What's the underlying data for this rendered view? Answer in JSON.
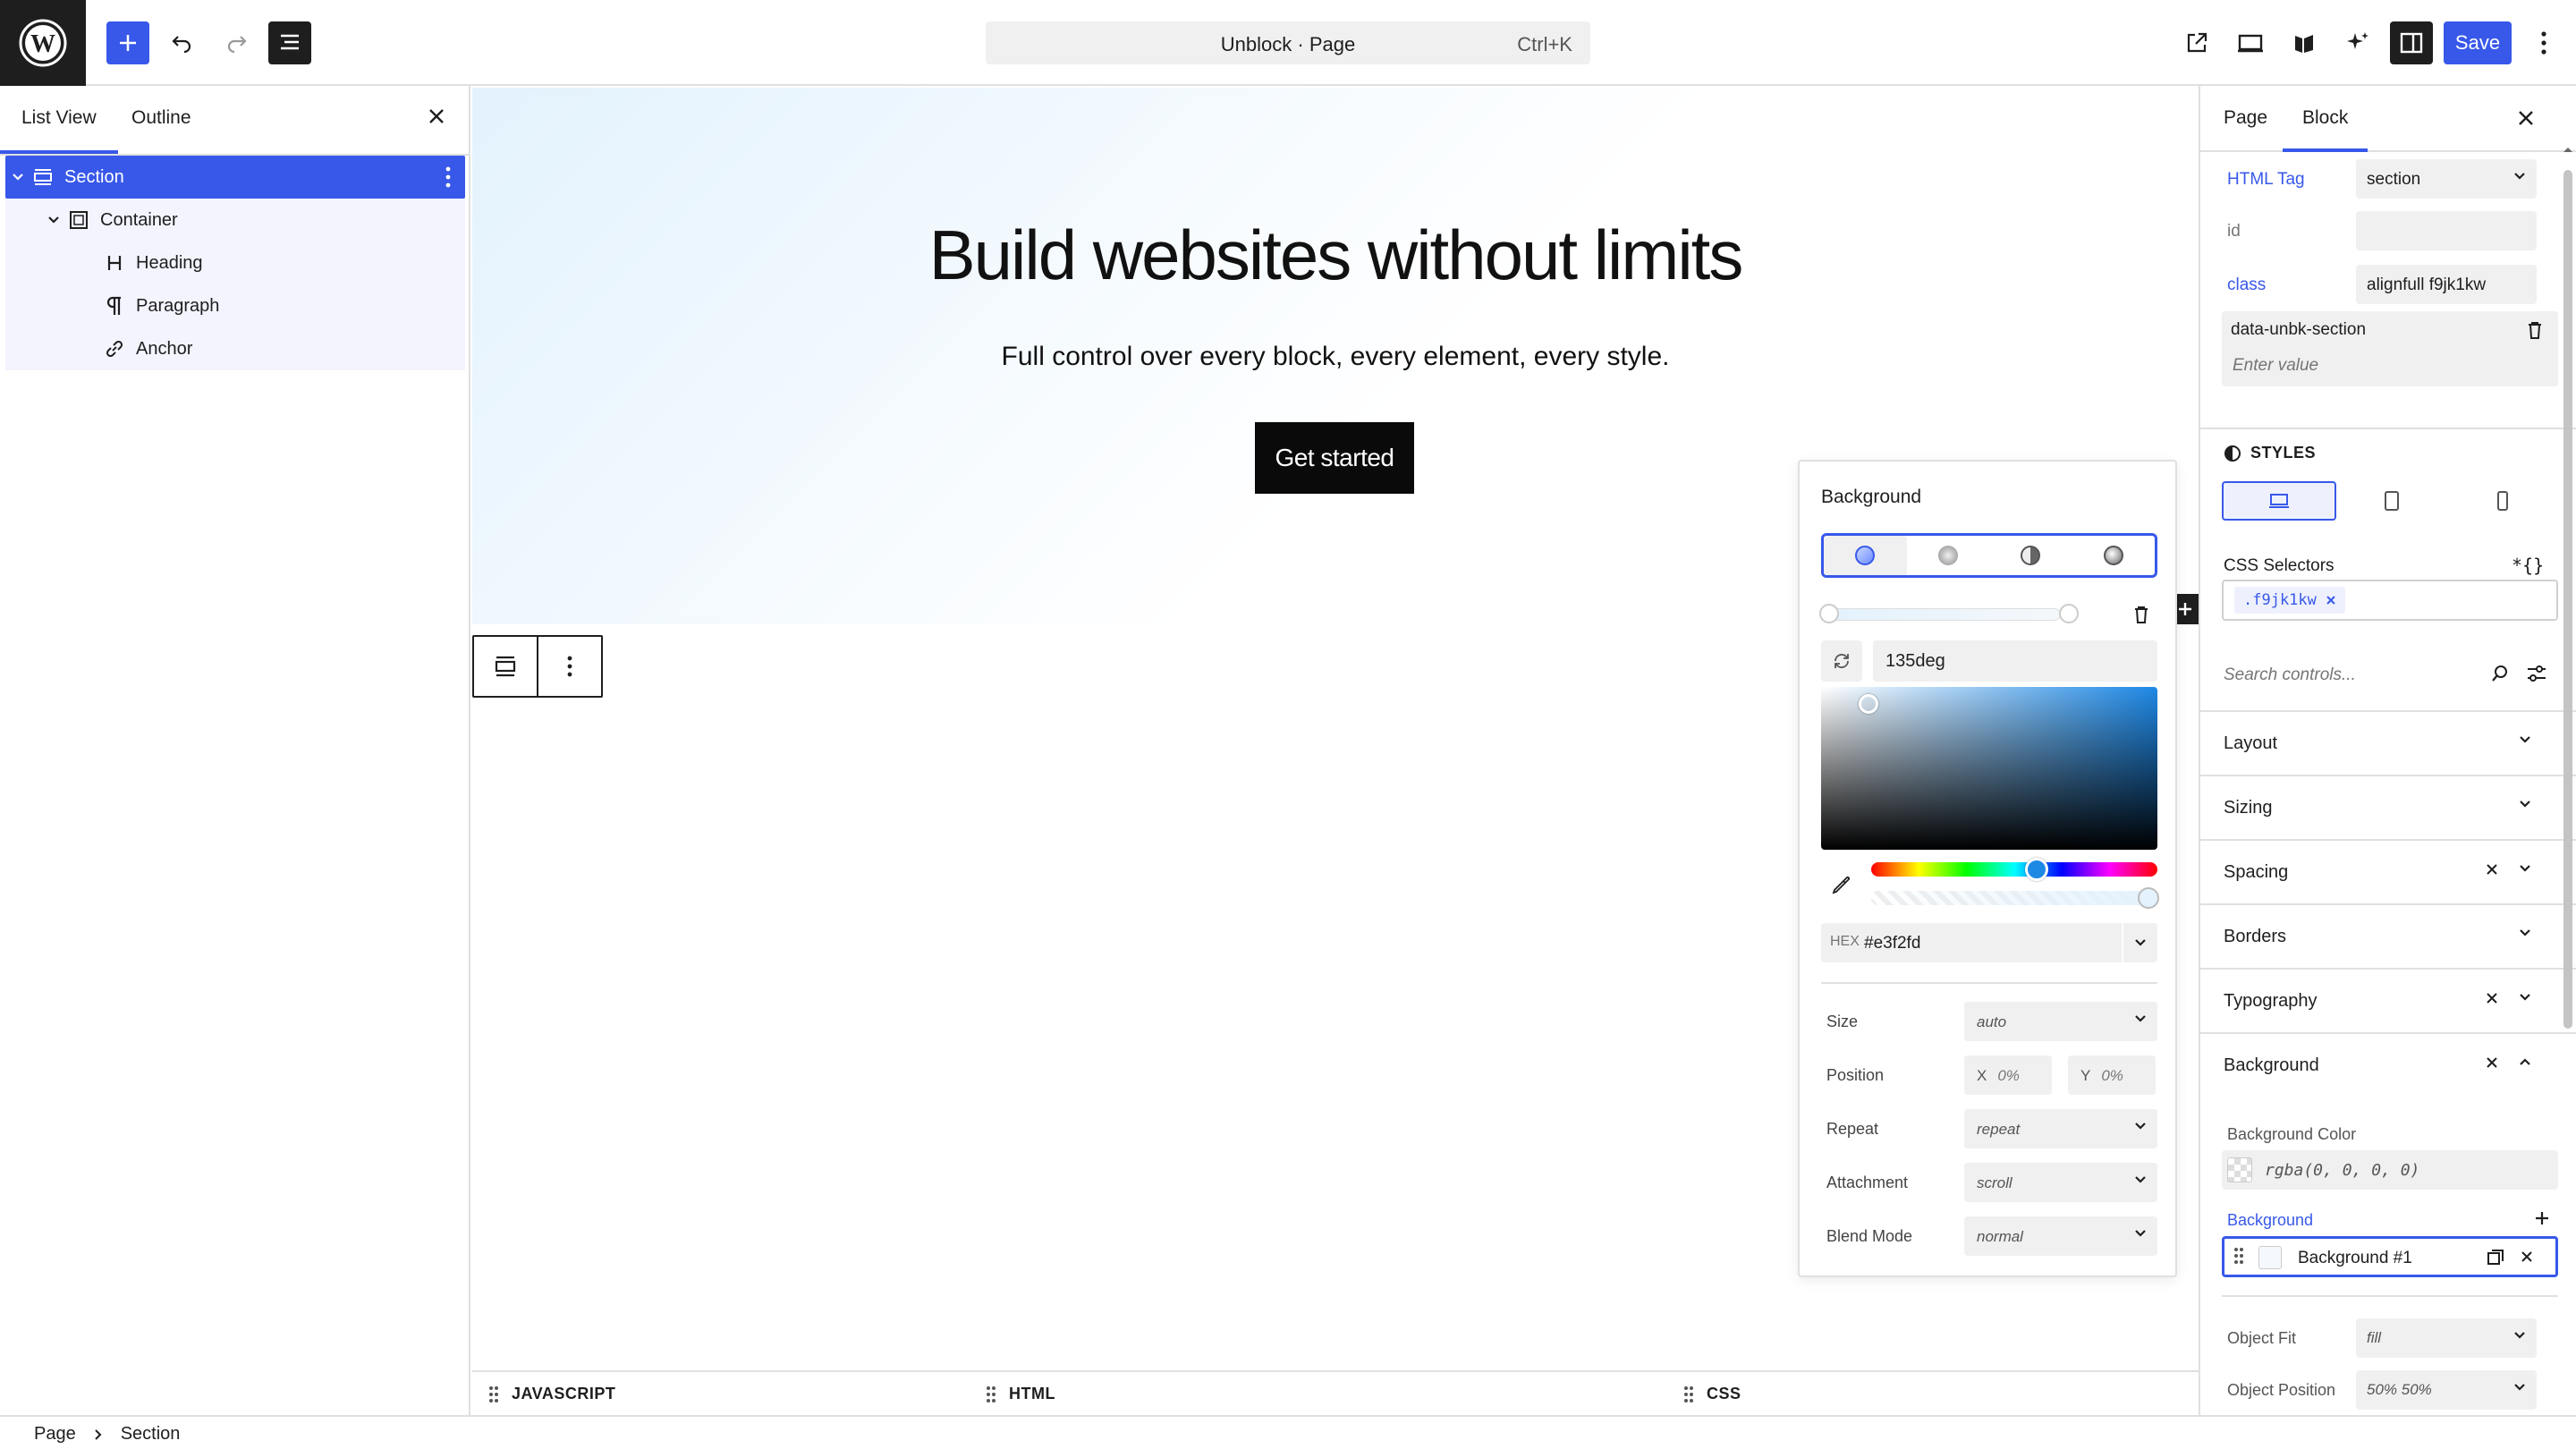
{
  "topbar": {
    "command_title": "Unblock · Page",
    "command_shortcut": "Ctrl+K",
    "save_label": "Save"
  },
  "left_panel": {
    "tabs": [
      "List View",
      "Outline"
    ],
    "tree": [
      {
        "label": "Section",
        "icon": "section-icon",
        "depth": 0,
        "selected": true
      },
      {
        "label": "Container",
        "icon": "container-icon",
        "depth": 1
      },
      {
        "label": "Heading",
        "icon": "heading-icon",
        "depth": 2
      },
      {
        "label": "Paragraph",
        "icon": "paragraph-icon",
        "depth": 2
      },
      {
        "label": "Anchor",
        "icon": "link-icon",
        "depth": 2
      }
    ]
  },
  "canvas": {
    "heading": "Build websites without limits",
    "paragraph": "Full control over every block, every element, every style.",
    "cta_label": "Get started"
  },
  "code_bar": {
    "tabs": [
      "JAVASCRIPT",
      "HTML",
      "CSS"
    ]
  },
  "breadcrumb": {
    "items": [
      "Page",
      "Section"
    ]
  },
  "bg_popover": {
    "title": "Background",
    "angle": "135deg",
    "hex_label": "HEX",
    "hex_value": "#e3f2fd",
    "size_label": "Size",
    "size_value": "auto",
    "position_label": "Position",
    "pos_x_label": "X",
    "pos_x_value": "0%",
    "pos_y_label": "Y",
    "pos_y_value": "0%",
    "repeat_label": "Repeat",
    "repeat_value": "repeat",
    "attachment_label": "Attachment",
    "attachment_value": "scroll",
    "blend_label": "Blend Mode",
    "blend_value": "normal"
  },
  "right_panel": {
    "tabs": [
      "Page",
      "Block"
    ],
    "html_tag_label": "HTML Tag",
    "html_tag_value": "section",
    "id_label": "id",
    "class_label": "class",
    "class_value": "alignfull f9jk1kw",
    "custom_attr_name": "data-unbk-section",
    "custom_attr_placeholder": "Enter value",
    "styles_label": "STYLES",
    "css_selectors_label": "CSS Selectors",
    "css_selectors_icon": "*{}",
    "selector_chip": ".f9jk1kw",
    "search_placeholder": "Search controls...",
    "accordions": [
      "Layout",
      "Sizing",
      "Spacing",
      "Borders",
      "Typography",
      "Background"
    ],
    "bg_color_label": "Background Color",
    "bg_color_value": "rgba(0, 0, 0, 0)",
    "background_label": "Background",
    "background_item": "Background #1",
    "object_fit_label": "Object Fit",
    "object_fit_value": "fill",
    "object_position_label": "Object Position",
    "object_position_value": "50% 50%"
  },
  "colors": {
    "accent": "#3858e9",
    "hero_gradient_start": "#e3f2fd"
  }
}
